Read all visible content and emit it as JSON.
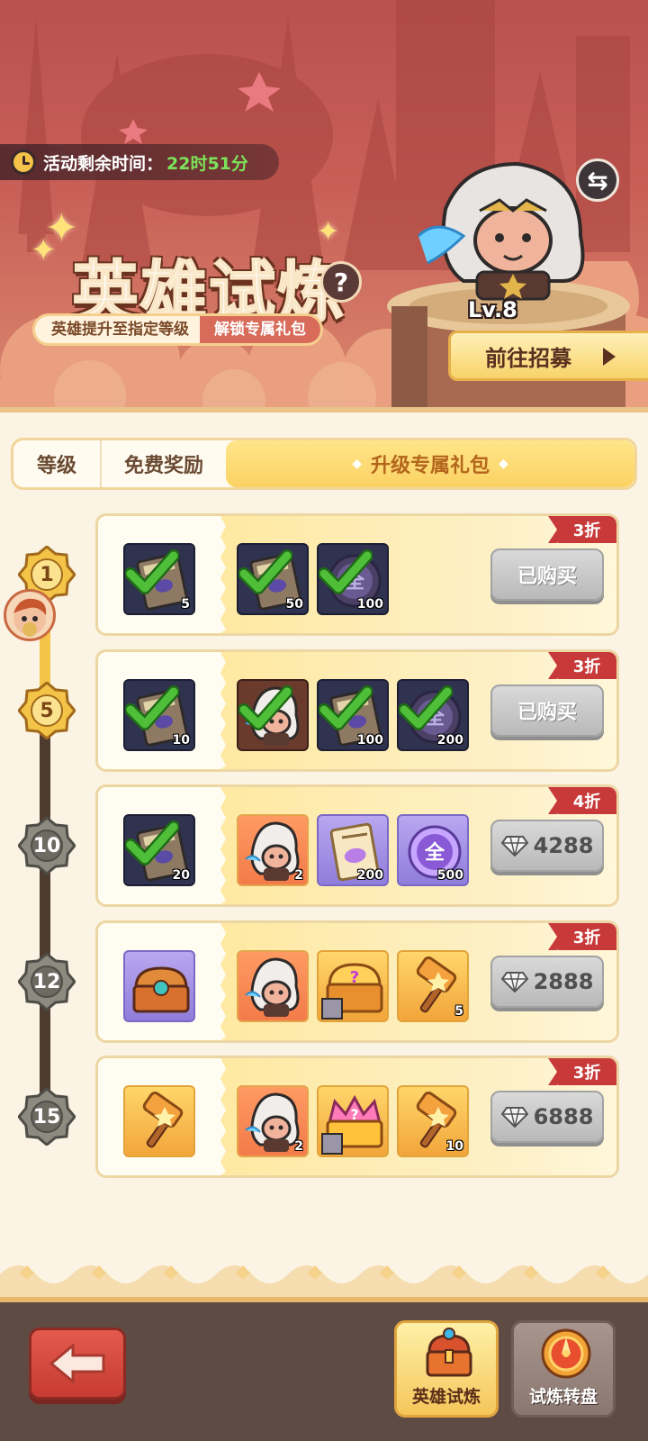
{
  "header": {
    "timer_label": "活动剩余时间：",
    "timer_value": "22时51分",
    "title": "英雄试炼",
    "subtitle_left": "英雄提升至指定等级",
    "subtitle_right": "解锁专属礼包",
    "help": "?",
    "swap": "⇆",
    "hero_level": "Lv.8",
    "recruit_button": "前往招募"
  },
  "tabs": [
    "等级",
    "免费奖励",
    "升级专属礼包"
  ],
  "timeline": {
    "levels": [
      "1",
      "5",
      "10",
      "12",
      "15"
    ],
    "reached": 2
  },
  "rows": [
    {
      "level": "1",
      "discount": "3折",
      "free": {
        "icon": "book-icon",
        "qty": "5",
        "claimed": true
      },
      "paid": [
        {
          "icon": "book-icon",
          "qty": "50",
          "claimed": true
        },
        {
          "icon": "orb-icon",
          "qty": "100",
          "claimed": true
        }
      ],
      "button": "已购买",
      "price": null
    },
    {
      "level": "5",
      "discount": "3折",
      "free": {
        "icon": "book-icon",
        "qty": "10",
        "claimed": true
      },
      "paid": [
        {
          "icon": "hero-icon",
          "qty": "",
          "claimed": true
        },
        {
          "icon": "book-icon",
          "qty": "100",
          "claimed": true
        },
        {
          "icon": "orb-icon",
          "qty": "200",
          "claimed": true
        }
      ],
      "button": "已购买",
      "price": null
    },
    {
      "level": "10",
      "discount": "4折",
      "free": {
        "icon": "book-icon",
        "qty": "20",
        "claimed": true
      },
      "paid": [
        {
          "icon": "hero-icon",
          "qty": "2",
          "claimed": false
        },
        {
          "icon": "scroll-icon",
          "qty": "200",
          "claimed": false
        },
        {
          "icon": "all-orb-icon",
          "qty": "500",
          "claimed": false,
          "text": "全"
        }
      ],
      "button": "",
      "price": "4288"
    },
    {
      "level": "12",
      "discount": "3折",
      "free": {
        "icon": "chest-icon",
        "qty": "",
        "claimed": false
      },
      "paid": [
        {
          "icon": "hero-icon",
          "qty": "",
          "claimed": false
        },
        {
          "icon": "gold-chest-icon",
          "qty": "",
          "claimed": false
        },
        {
          "icon": "hammer-icon",
          "qty": "5",
          "claimed": false
        }
      ],
      "button": "",
      "price": "2888"
    },
    {
      "level": "15",
      "discount": "3折",
      "free": {
        "icon": "hammer-icon",
        "qty": "",
        "claimed": false
      },
      "paid": [
        {
          "icon": "hero-icon",
          "qty": "2",
          "claimed": false
        },
        {
          "icon": "crown-chest-icon",
          "qty": "",
          "claimed": false
        },
        {
          "icon": "hammer-icon",
          "qty": "10",
          "claimed": false
        }
      ],
      "button": "",
      "price": "6888"
    }
  ],
  "bottom_nav": {
    "hero_trial": "英雄试炼",
    "trial_wheel": "试炼转盘"
  },
  "colors": {
    "accent_red": "#c83a3a",
    "gold": "#f3c447",
    "header_bg": "#c85f57",
    "check_green": "#4fbf3a"
  }
}
